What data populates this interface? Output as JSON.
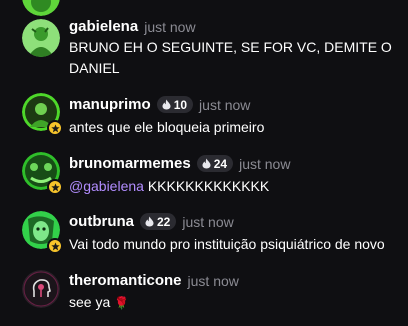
{
  "colors": {
    "background": "#0f0f12",
    "username": "#ffffff",
    "timestamp": "#8b8b93",
    "mention": "#b28dff",
    "badge_bg": "#2b2b31",
    "star": "#f7c42b",
    "flame": "#e9e9ee"
  },
  "messages": [
    {
      "username": "gabielena",
      "time": "just now",
      "text": "BRUNO EH O SEGUINTE, SE FOR VC, DEMITE O DANIEL",
      "avatar_icon": "green-profile-photo"
    },
    {
      "username": "manuprimo",
      "badge": "10",
      "time": "just now",
      "text": "antes que ele bloqueia primeiro",
      "avatar_icon": "green-profile-photo"
    },
    {
      "username": "brunomarmemes",
      "badge": "24",
      "time": "just now",
      "mention": "@gabielena",
      "text": " KKKKKKKKKKKKK",
      "avatar_icon": "green-profile-photo"
    },
    {
      "username": "outbruna",
      "badge": "22",
      "time": "just now",
      "text": "Vai todo mundo pro instituição psiquiátrico de novo",
      "avatar_icon": "green-profile-photo"
    },
    {
      "username": "theromanticone",
      "time": "just now",
      "text": "see ya",
      "emoji": "🌹",
      "avatar_icon": "head-profile-icon"
    }
  ]
}
